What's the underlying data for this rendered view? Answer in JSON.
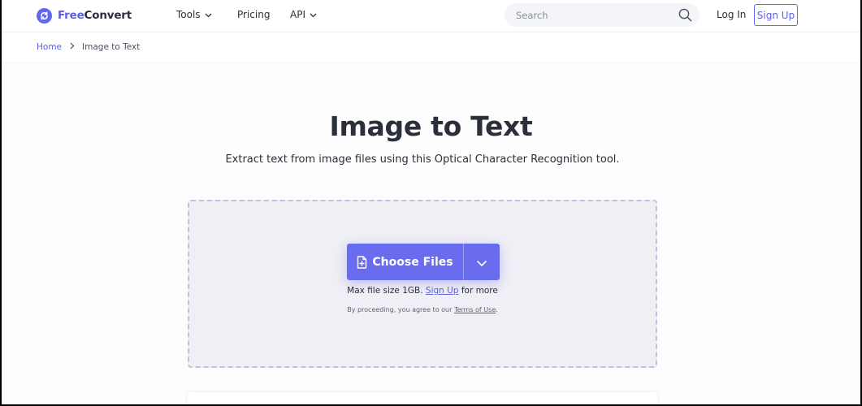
{
  "brand": {
    "name_part1": "Free",
    "name_part2": "Convert",
    "color": "#6366f1"
  },
  "nav": {
    "tools": "Tools",
    "pricing": "Pricing",
    "api": "API"
  },
  "search": {
    "placeholder": "Search"
  },
  "auth": {
    "login": "Log In",
    "signup": "Sign Up"
  },
  "breadcrumb": {
    "home": "Home",
    "current": "Image to Text"
  },
  "hero": {
    "title": "Image to Text",
    "subtitle": "Extract text from image files using this Optical Character Recognition tool."
  },
  "upload": {
    "button_label": "Choose Files",
    "max_size_prefix": "Max file size 1GB.",
    "signup_link": "Sign Up",
    "max_size_suffix": "for more",
    "terms_prefix": "By proceeding, you agree to our",
    "terms_link": "Terms of Use",
    "terms_suffix": "."
  },
  "icons": {
    "logo": "refresh-circle-icon",
    "search": "search-icon",
    "chevron": "chevron-down-icon",
    "file_add": "file-plus-icon"
  }
}
